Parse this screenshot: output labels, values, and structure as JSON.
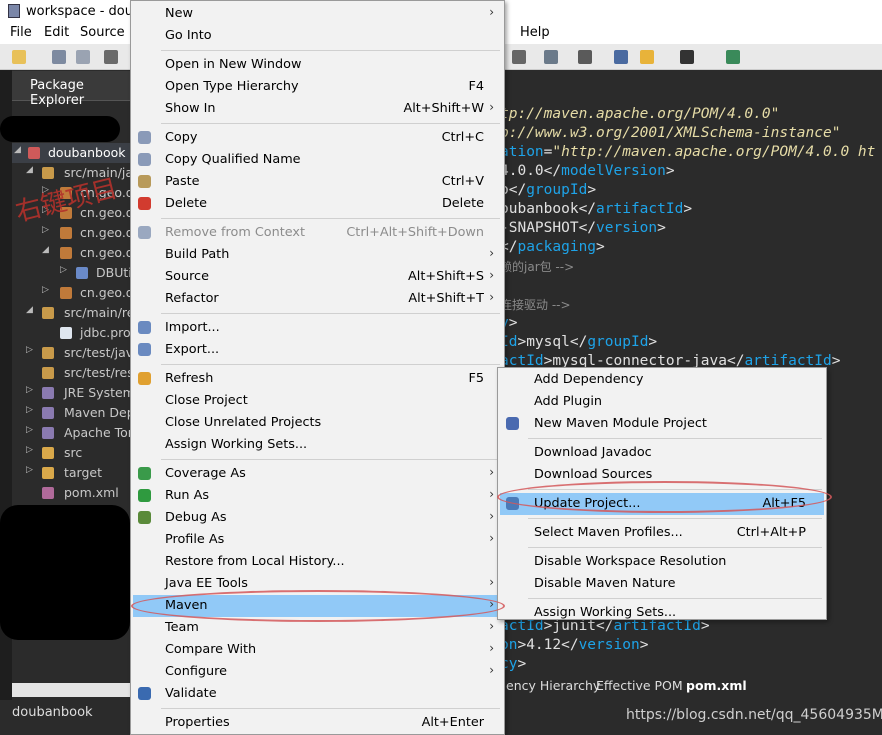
{
  "window": {
    "title": "workspace - doub"
  },
  "menubar": {
    "items": [
      "File",
      "Edit",
      "Source",
      "Help"
    ]
  },
  "explorer": {
    "tab_label": "Package Explorer",
    "rows": [
      {
        "label": "doubanbook"
      },
      {
        "label": "src/main/ja"
      },
      {
        "label": "cn.geo.d"
      },
      {
        "label": "cn.geo.d"
      },
      {
        "label": "cn.geo.d"
      },
      {
        "label": "cn.geo.d"
      },
      {
        "label": "DBUti"
      },
      {
        "label": "cn.geo.d"
      },
      {
        "label": "src/main/re"
      },
      {
        "label": "jdbc.pro"
      },
      {
        "label": "src/test/java"
      },
      {
        "label": "src/test/res"
      },
      {
        "label": "JRE System"
      },
      {
        "label": "Maven Dep"
      },
      {
        "label": "Apache Tor"
      },
      {
        "label": "src"
      },
      {
        "label": "target"
      },
      {
        "label": "pom.xml"
      }
    ],
    "annotation": "右键项目"
  },
  "editor": {
    "lines": [
      {
        "parts": [
          [
            "str",
            "tp://maven.apache.org/POM/4.0.0\""
          ]
        ]
      },
      {
        "parts": [
          [
            "str",
            "p://www.w3.org/2001/XMLSchema-instance\""
          ]
        ]
      },
      {
        "parts": [
          [
            "kw",
            "ation"
          ],
          [
            "plain",
            "="
          ],
          [
            "str",
            "\"http://maven.apache.org/POM/4.0.0 ht"
          ]
        ]
      },
      {
        "parts": [
          [
            "plain",
            "4.0.0</"
          ],
          [
            "kw",
            "modelVersion"
          ],
          [
            "plain",
            ">"
          ]
        ]
      },
      {
        "parts": [
          [
            "plain",
            "o</"
          ],
          [
            "kw",
            "groupId"
          ],
          [
            "plain",
            ">"
          ]
        ]
      },
      {
        "parts": [
          [
            "plain",
            "oubanbook</"
          ],
          [
            "kw",
            "artifactId"
          ],
          [
            "plain",
            ">"
          ]
        ]
      },
      {
        "parts": [
          [
            "plain",
            "-SNAPSHOT</"
          ],
          [
            "kw",
            "version"
          ],
          [
            "plain",
            ">"
          ]
        ]
      },
      {
        "parts": [
          [
            "plain",
            "</"
          ],
          [
            "kw",
            "packaging"
          ],
          [
            "plain",
            ">"
          ]
        ]
      },
      {
        "parts": [
          [
            "cmt",
            "赖的jar包 -->"
          ]
        ]
      },
      {
        "parts": [
          [
            "plain",
            ""
          ]
        ]
      },
      {
        "parts": [
          [
            "cmt",
            "连接驱动 -->"
          ]
        ]
      },
      {
        "parts": [
          [
            "kw",
            "y"
          ],
          [
            "plain",
            ">"
          ]
        ]
      },
      {
        "parts": [
          [
            "kw",
            "Id"
          ],
          [
            "plain",
            ">mysql</"
          ],
          [
            "kw",
            "groupId"
          ],
          [
            "plain",
            ">"
          ]
        ]
      },
      {
        "parts": [
          [
            "kw",
            "actId"
          ],
          [
            "plain",
            ">mysql-connector-java</"
          ],
          [
            "kw",
            "artifactId"
          ],
          [
            "plain",
            ">"
          ]
        ]
      }
    ],
    "bottom_lines": [
      {
        "parts": [
          [
            "kw",
            "actId"
          ],
          [
            "plain",
            ">junit</"
          ],
          [
            "kw",
            "artifactId"
          ],
          [
            "plain",
            ">"
          ]
        ]
      },
      {
        "parts": [
          [
            "kw",
            "on"
          ],
          [
            "plain",
            ">4.12</"
          ],
          [
            "kw",
            "version"
          ],
          [
            "plain",
            ">"
          ]
        ]
      },
      {
        "parts": [
          [
            "kw",
            "cy"
          ],
          [
            "plain",
            ">"
          ]
        ]
      }
    ],
    "tabs": [
      "ency Hierarchy",
      "Effective POM",
      "pom.xml"
    ]
  },
  "status": {
    "project": "doubanbook",
    "watermark": "https://blog.csdn.net/qq_45604935M"
  },
  "context_menu": {
    "items": [
      {
        "label": "New",
        "submenu": true
      },
      {
        "label": "Go Into"
      },
      {
        "sep": true
      },
      {
        "label": "Open in New Window"
      },
      {
        "label": "Open Type Hierarchy",
        "key": "F4"
      },
      {
        "label": "Show In",
        "key": "Alt+Shift+W",
        "submenu": true
      },
      {
        "sep": true
      },
      {
        "label": "Copy",
        "key": "Ctrl+C",
        "icon": "copy-icon"
      },
      {
        "label": "Copy Qualified Name",
        "icon": "copy-qualified-icon"
      },
      {
        "label": "Paste",
        "key": "Ctrl+V",
        "icon": "paste-icon"
      },
      {
        "label": "Delete",
        "key": "Delete",
        "icon": "delete-icon"
      },
      {
        "sep": true
      },
      {
        "label": "Remove from Context",
        "key": "Ctrl+Alt+Shift+Down",
        "disabled": true,
        "icon": "remove-context-icon"
      },
      {
        "label": "Build Path",
        "submenu": true
      },
      {
        "label": "Source",
        "key": "Alt+Shift+S",
        "submenu": true
      },
      {
        "label": "Refactor",
        "key": "Alt+Shift+T",
        "submenu": true
      },
      {
        "sep": true
      },
      {
        "label": "Import...",
        "icon": "import-icon"
      },
      {
        "label": "Export...",
        "icon": "export-icon"
      },
      {
        "sep": true
      },
      {
        "label": "Refresh",
        "key": "F5",
        "icon": "refresh-icon"
      },
      {
        "label": "Close Project"
      },
      {
        "label": "Close Unrelated Projects"
      },
      {
        "label": "Assign Working Sets..."
      },
      {
        "sep": true
      },
      {
        "label": "Coverage As",
        "submenu": true,
        "icon": "coverage-icon"
      },
      {
        "label": "Run As",
        "submenu": true,
        "icon": "run-icon"
      },
      {
        "label": "Debug As",
        "submenu": true,
        "icon": "debug-icon"
      },
      {
        "label": "Profile As",
        "submenu": true
      },
      {
        "label": "Restore from Local History..."
      },
      {
        "label": "Java EE Tools",
        "submenu": true
      },
      {
        "label": "Maven",
        "submenu": true,
        "highlighted": true
      },
      {
        "label": "Team",
        "submenu": true
      },
      {
        "label": "Compare With",
        "submenu": true
      },
      {
        "label": "Configure",
        "submenu": true
      },
      {
        "label": "Validate",
        "icon": "validate-check-icon"
      },
      {
        "sep": true
      },
      {
        "label": "Properties",
        "key": "Alt+Enter"
      }
    ]
  },
  "maven_submenu": {
    "items": [
      {
        "label": "Add Dependency"
      },
      {
        "label": "Add Plugin"
      },
      {
        "label": "New Maven Module Project",
        "icon": "maven-module-icon"
      },
      {
        "sep": true
      },
      {
        "label": "Download Javadoc"
      },
      {
        "label": "Download Sources"
      },
      {
        "sep": true
      },
      {
        "label": "Update Project...",
        "key": "Alt+F5",
        "highlighted": true,
        "icon": "update-project-icon"
      },
      {
        "sep": true
      },
      {
        "label": "Select Maven Profiles...",
        "key": "Ctrl+Alt+P"
      },
      {
        "sep": true
      },
      {
        "label": "Disable Workspace Resolution"
      },
      {
        "label": "Disable Maven Nature"
      },
      {
        "sep": true
      },
      {
        "label": "Assign Working Sets..."
      }
    ]
  },
  "colors": {
    "highlight": "#91c9f7",
    "annotation_red": "#d4585a",
    "xml_tag": "#1ea3e8"
  }
}
